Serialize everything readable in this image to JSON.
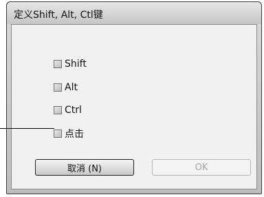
{
  "dialog": {
    "title": "定义Shift, Alt, Ctl键"
  },
  "options": [
    {
      "label": "Shift",
      "checked": false
    },
    {
      "label": "Alt",
      "checked": false
    },
    {
      "label": "Ctrl",
      "checked": false
    },
    {
      "label": "点击",
      "checked": false
    }
  ],
  "buttons": {
    "cancel_label": "取消 (N)",
    "ok_label": "OK",
    "ok_enabled": false
  },
  "annotation": {
    "callout_target": "点击"
  }
}
